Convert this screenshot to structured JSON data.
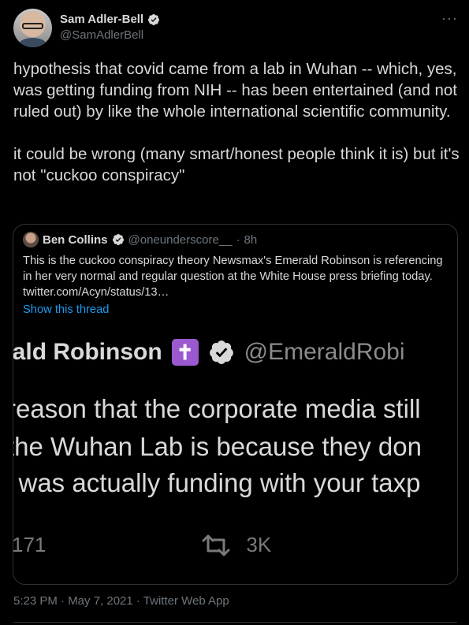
{
  "author": {
    "name": "Sam Adler-Bell",
    "handle": "@SamAdlerBell"
  },
  "more_label": "···",
  "tweet_text": "hypothesis that covid came from a lab in Wuhan -- which, yes, was getting funding from NIH -- has been entertained (and not ruled out) by like the whole international scientific community.\n\nit could be wrong (many smart/honest people think it is) but it's not \"cuckoo conspiracy\"",
  "quoted": {
    "name": "Ben Collins",
    "handle": "@oneunderscore__",
    "separator": "·",
    "time": "8h",
    "text": "This is the cuckoo conspiracy theory Newsmax's Emerald Robinson is referencing in her very normal and regular question at the White House press briefing today.  twitter.com/Acyn/status/13…",
    "show_thread": "Show this thread",
    "media": {
      "name_fragment": "rald Robinson",
      "cross_symbol": "✝",
      "handle_fragment": "@EmeraldRobi",
      "line1": "reason that the corporate media still",
      "line2": " the Wuhan Lab is because they don",
      "line3": "i was actually funding with your taxp",
      "reply_count": "171",
      "retweet_count": "3K"
    }
  },
  "timestamp": "5:23 PM · May 7, 2021 · Twitter Web App",
  "colors": {
    "background": "#000000",
    "text": "#d9d9d9",
    "muted": "#6e767d",
    "link": "#1d9bf0",
    "border": "#2f3336",
    "cross_badge": "#9b59d0"
  },
  "icons": [
    "verified-badge-icon",
    "more-icon",
    "cross-emoji-icon",
    "retweet-icon",
    "like-icon"
  ]
}
